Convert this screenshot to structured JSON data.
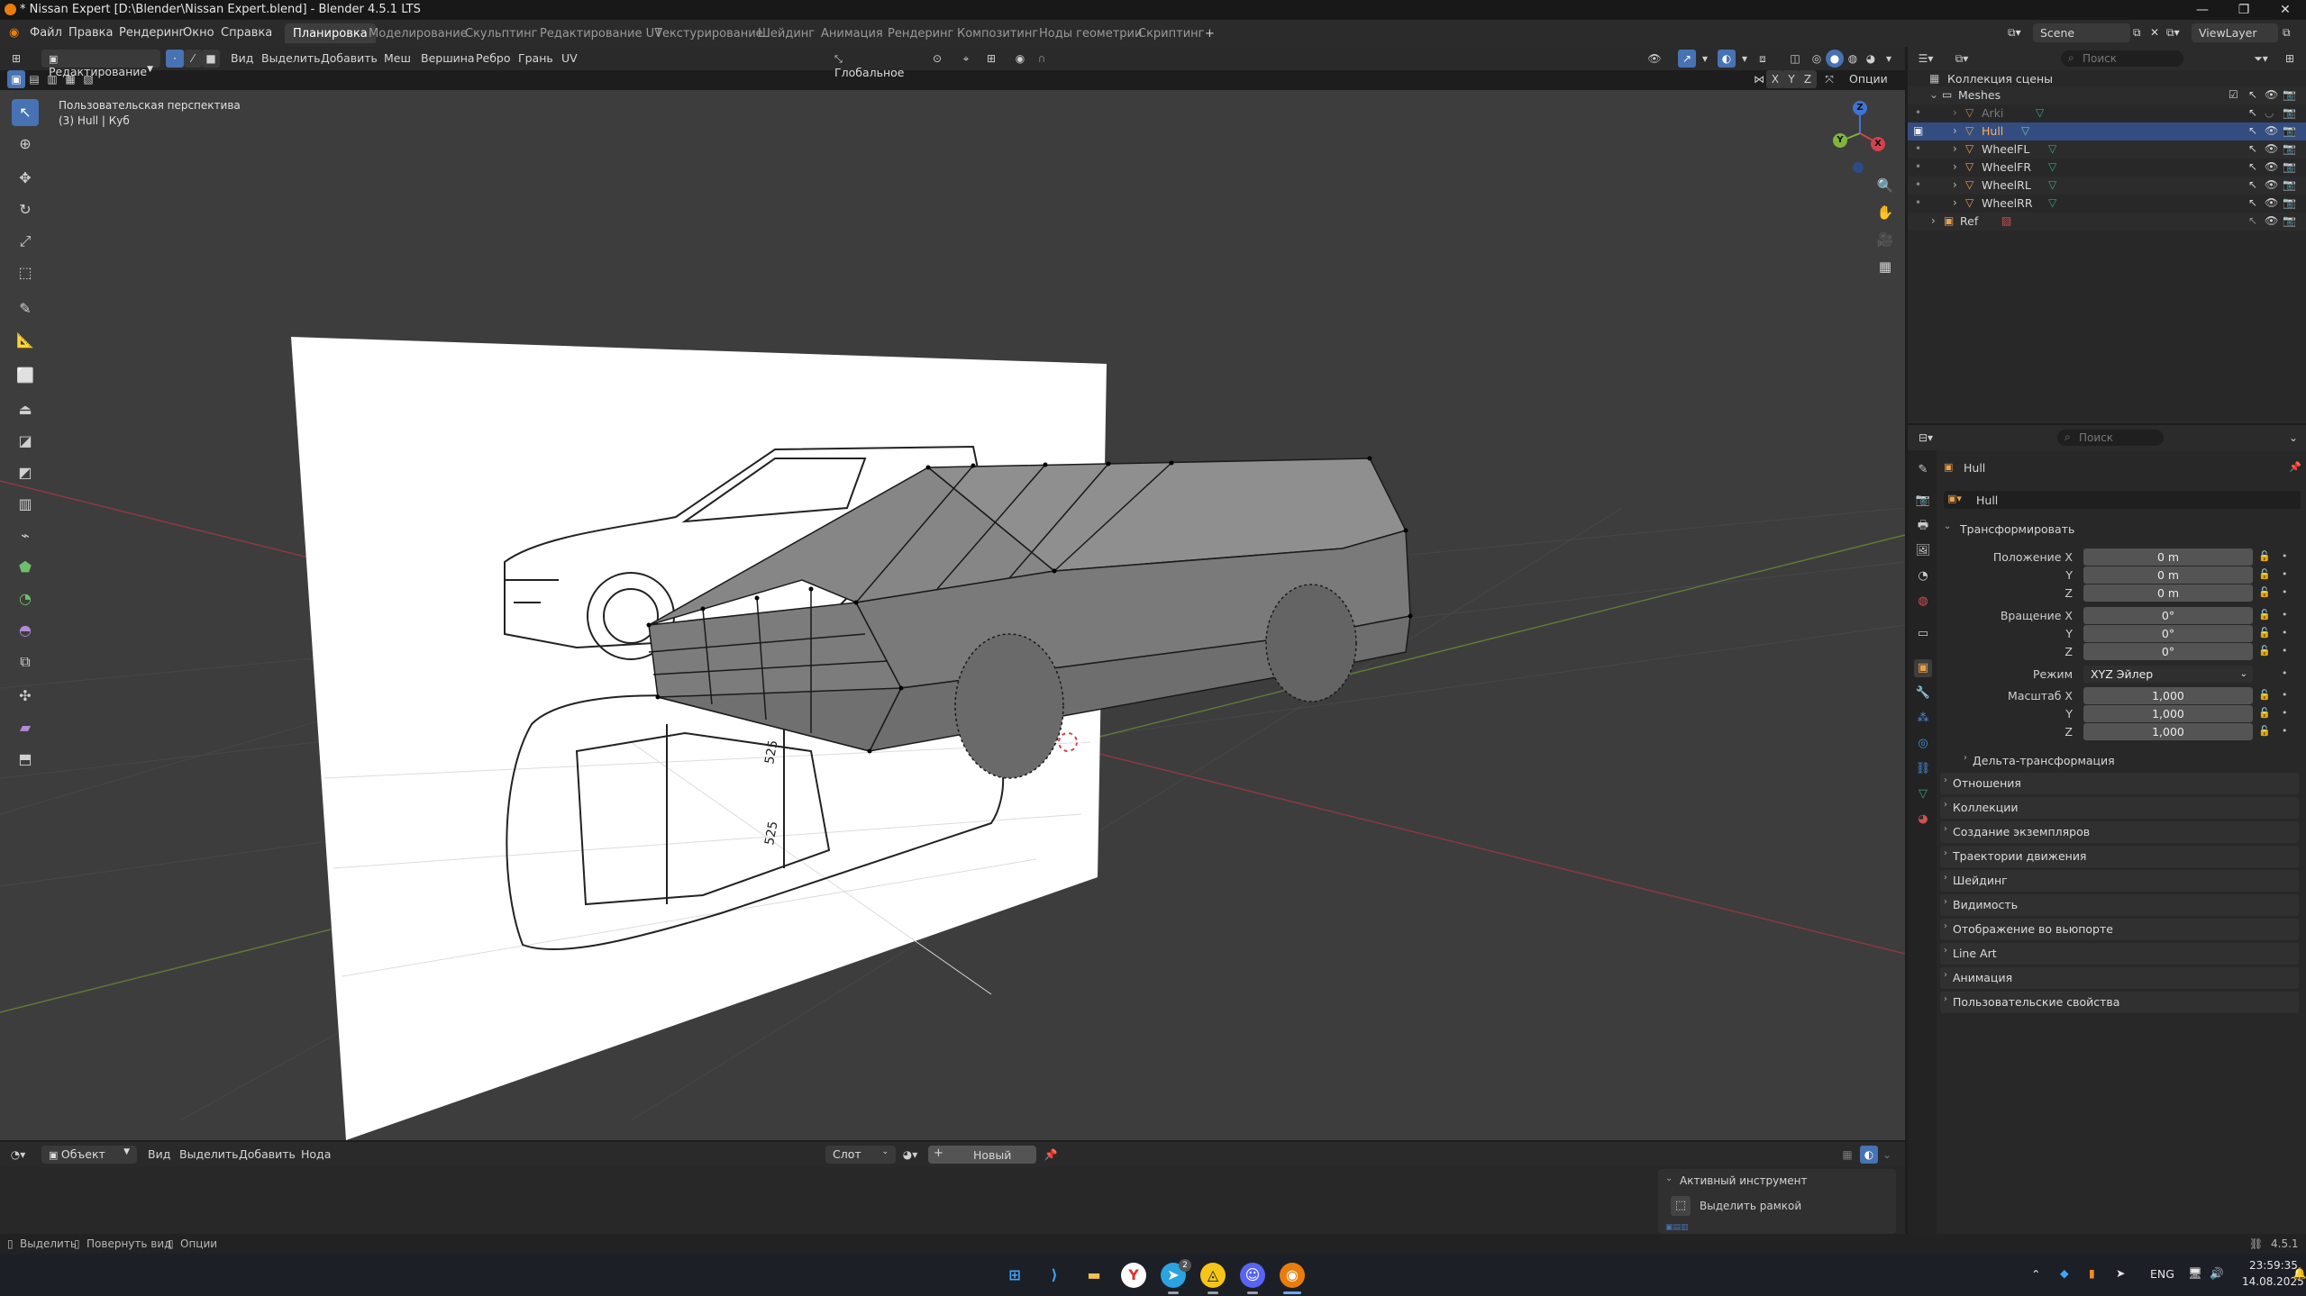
{
  "window": {
    "title": "* Nissan Expert [D:\\Blender\\Nissan Expert.blend] - Blender 4.5.1 LTS"
  },
  "menubar": {
    "items": [
      "Файл",
      "Правка",
      "Рендеринг",
      "Окно",
      "Справка"
    ],
    "workspaces": [
      "Планировка",
      "Моделирование",
      "Скульптинг",
      "Редактирование UV",
      "Текстурирование",
      "Шейдинг",
      "Анимация",
      "Рендеринг",
      "Композитинг",
      "Ноды геометрии",
      "Скриптинг"
    ],
    "active_workspace": "Планировка",
    "add_tab": "+",
    "scene": "Scene",
    "view_layer": "ViewLayer"
  },
  "viewport_header": {
    "mode": "Редактирование",
    "menus": [
      "Вид",
      "Выделить",
      "Добавить",
      "Меш",
      "Вершина",
      "Ребро",
      "Грань",
      "UV"
    ],
    "orientation": "Глобальное",
    "options": "Опции",
    "axes": [
      "X",
      "Y",
      "Z"
    ]
  },
  "viewport": {
    "view_name": "Пользовательская перспектива",
    "object_info": "(3) Hull | Куб",
    "gizmo": {
      "x": "X",
      "y": "Y",
      "z": "Z"
    },
    "ref_labels": [
      "525",
      "525"
    ]
  },
  "outliner": {
    "search_placeholder": "Поиск",
    "collection_root": "Коллекция сцены",
    "rows": [
      {
        "name": "Meshes"
      },
      {
        "name": "Arki"
      },
      {
        "name": "Hull"
      },
      {
        "name": "WheelFL"
      },
      {
        "name": "WheelFR"
      },
      {
        "name": "WheelRL"
      },
      {
        "name": "WheelRR"
      },
      {
        "name": "Ref"
      }
    ]
  },
  "properties": {
    "search_placeholder": "Поиск",
    "object_name": "Hull",
    "object_name_field": "Hull",
    "transform_title": "Трансформировать",
    "location_label": "Положение X",
    "rotation_label": "Вращение X",
    "scale_label": "Масштаб X",
    "y_label": "Y",
    "z_label": "Z",
    "location": [
      "0 m",
      "0 m",
      "0 m"
    ],
    "rotation": [
      "0°",
      "0°",
      "0°"
    ],
    "mode_label": "Режим",
    "mode_value": "XYZ Эйлер",
    "scale": [
      "1,000",
      "1,000",
      "1,000"
    ],
    "delta_title": "Дельта-трансформация",
    "panels": [
      "Отношения",
      "Коллекции",
      "Создание экземпляров",
      "Траектории движения",
      "Шейдинг",
      "Видимость",
      "Отображение во вьюпорте",
      "Line Art",
      "Анимация",
      "Пользовательские свойства"
    ]
  },
  "bottom_editor": {
    "mode": "Объект",
    "menus": [
      "Вид",
      "Выделить",
      "Добавить",
      "Нода"
    ],
    "slot": "Слот",
    "new_button": "Новый",
    "active_tool_title": "Активный инструмент",
    "active_tool_name": "Выделить рамкой"
  },
  "statusbar": {
    "items": [
      "Выделить",
      "Повернуть вид",
      "Опции"
    ],
    "version": "4.5.1"
  },
  "taskbar": {
    "language": "ENG",
    "time": "23:59:35",
    "date": "14.08.2025",
    "badge": "2"
  },
  "colors": {
    "accent": "#4772b3",
    "selected_row": "#334d80",
    "viewport_bg": "#3d3d3d",
    "x_axis": "#d0434f",
    "y_axis": "#7fb53b",
    "z_axis": "#3f74d6"
  }
}
